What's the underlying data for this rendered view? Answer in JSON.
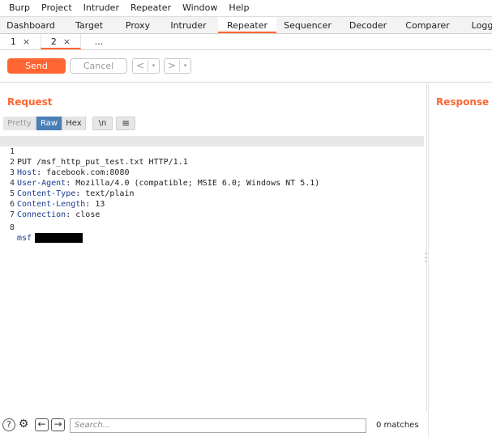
{
  "menu": [
    "Burp",
    "Project",
    "Intruder",
    "Repeater",
    "Window",
    "Help"
  ],
  "tool_tabs": [
    "Dashboard",
    "Target",
    "Proxy",
    "Intruder",
    "Repeater",
    "Sequencer",
    "Decoder",
    "Comparer",
    "Logg"
  ],
  "active_tool_tab": "Repeater",
  "sub_tabs": [
    {
      "label": "1",
      "close": "×"
    },
    {
      "label": "2",
      "close": "×"
    },
    {
      "label": "...",
      "close": ""
    }
  ],
  "toolbar": {
    "send": "Send",
    "cancel": "Cancel",
    "back": "<",
    "forward": ">",
    "dropdown": "▾"
  },
  "request": {
    "title": "Request",
    "view_tabs": [
      "Pretty",
      "Raw",
      "Hex"
    ],
    "active_view": "Raw",
    "newline_btn": "\\n",
    "menu_btn": "≡",
    "lines": [
      {
        "n": "1",
        "key": "",
        "text": "PUT /msf_http_put_test.txt HTTP/1.1"
      },
      {
        "n": "2",
        "key": "Host",
        "text": ": facebook.com:8080"
      },
      {
        "n": "3",
        "key": "User-Agent",
        "text": ": Mozilla/4.0 (compatible; MSIE 6.0; Windows NT 5.1)"
      },
      {
        "n": "4",
        "key": "Content-Type",
        "text": ": text/plain"
      },
      {
        "n": "5",
        "key": "Content-Length",
        "text": ": 13"
      },
      {
        "n": "6",
        "key": "Connection",
        "text": ": close"
      },
      {
        "n": "7",
        "key": "",
        "text": ""
      },
      {
        "n": "8",
        "key": "msf",
        "text": ""
      }
    ]
  },
  "response": {
    "title": "Response"
  },
  "search": {
    "help": "?",
    "settings": "⚙",
    "prev": "←",
    "next": "→",
    "placeholder": "Search...",
    "matches": "0 matches"
  }
}
